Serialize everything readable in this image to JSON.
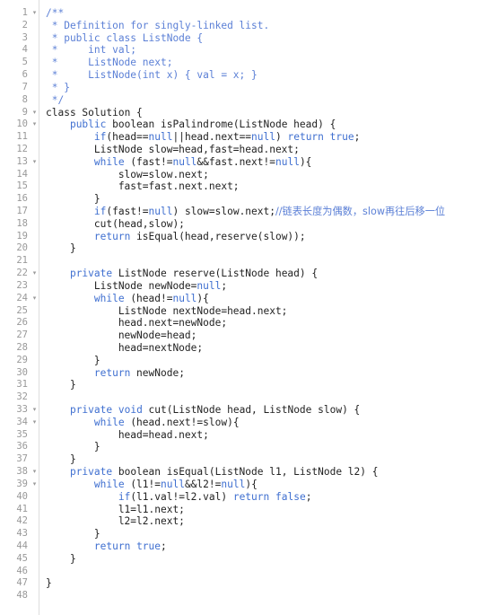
{
  "editor": {
    "name": "code-editor",
    "language": "java",
    "total_lines": 48,
    "colors": {
      "background": "#ffffff",
      "gutter_text": "#999999",
      "gutter_rule": "#dddddd",
      "comment": "#5c80d6",
      "keyword": "#3f6fd0",
      "literal": "#5a7fd4",
      "plain": "#222222",
      "fold_marker": "#9a9a9a"
    },
    "fold_marker_glyph": "▾",
    "fold_lines": [
      1,
      9,
      10,
      13,
      22,
      24,
      33,
      34,
      38,
      39
    ],
    "lines": [
      {
        "n": 1,
        "fold": true,
        "tokens": [
          {
            "t": "/**",
            "c": "cmt"
          }
        ]
      },
      {
        "n": 2,
        "fold": false,
        "tokens": [
          {
            "t": " * Definition for singly-linked list.",
            "c": "cmt"
          }
        ]
      },
      {
        "n": 3,
        "fold": false,
        "tokens": [
          {
            "t": " * public class ListNode {",
            "c": "cmt"
          }
        ]
      },
      {
        "n": 4,
        "fold": false,
        "tokens": [
          {
            "t": " *     int val;",
            "c": "cmt"
          }
        ]
      },
      {
        "n": 5,
        "fold": false,
        "tokens": [
          {
            "t": " *     ListNode next;",
            "c": "cmt"
          }
        ]
      },
      {
        "n": 6,
        "fold": false,
        "tokens": [
          {
            "t": " *     ListNode(int x) { val = x; }",
            "c": "cmt"
          }
        ]
      },
      {
        "n": 7,
        "fold": false,
        "tokens": [
          {
            "t": " * }",
            "c": "cmt"
          }
        ]
      },
      {
        "n": 8,
        "fold": false,
        "tokens": [
          {
            "t": " */",
            "c": "cmt"
          }
        ]
      },
      {
        "n": 9,
        "fold": true,
        "tokens": [
          {
            "t": "class",
            "c": "plain"
          },
          {
            "t": " Solution {",
            "c": "plain"
          }
        ]
      },
      {
        "n": 10,
        "fold": true,
        "tokens": [
          {
            "t": "    ",
            "c": "plain"
          },
          {
            "t": "public",
            "c": "kw"
          },
          {
            "t": " boolean isPalindrome(ListNode head) {",
            "c": "plain"
          }
        ]
      },
      {
        "n": 11,
        "fold": false,
        "tokens": [
          {
            "t": "        ",
            "c": "plain"
          },
          {
            "t": "if",
            "c": "kw"
          },
          {
            "t": "(head==",
            "c": "plain"
          },
          {
            "t": "null",
            "c": "kw"
          },
          {
            "t": "||head.next==",
            "c": "plain"
          },
          {
            "t": "null",
            "c": "kw"
          },
          {
            "t": ") ",
            "c": "plain"
          },
          {
            "t": "return",
            "c": "kw"
          },
          {
            "t": " ",
            "c": "plain"
          },
          {
            "t": "true",
            "c": "kw"
          },
          {
            "t": ";",
            "c": "plain"
          }
        ]
      },
      {
        "n": 12,
        "fold": false,
        "tokens": [
          {
            "t": "        ListNode slow=head,fast=head.next;",
            "c": "plain"
          }
        ]
      },
      {
        "n": 13,
        "fold": true,
        "tokens": [
          {
            "t": "        ",
            "c": "plain"
          },
          {
            "t": "while",
            "c": "kw"
          },
          {
            "t": " (fast!=",
            "c": "plain"
          },
          {
            "t": "null",
            "c": "kw"
          },
          {
            "t": "&&fast.next!=",
            "c": "plain"
          },
          {
            "t": "null",
            "c": "kw"
          },
          {
            "t": "){",
            "c": "plain"
          }
        ]
      },
      {
        "n": 14,
        "fold": false,
        "tokens": [
          {
            "t": "            slow=slow.next;",
            "c": "plain"
          }
        ]
      },
      {
        "n": 15,
        "fold": false,
        "tokens": [
          {
            "t": "            fast=fast.next.next;",
            "c": "plain"
          }
        ]
      },
      {
        "n": 16,
        "fold": false,
        "tokens": [
          {
            "t": "        }",
            "c": "plain"
          }
        ]
      },
      {
        "n": 17,
        "fold": false,
        "tokens": [
          {
            "t": "        ",
            "c": "plain"
          },
          {
            "t": "if",
            "c": "kw"
          },
          {
            "t": "(fast!=",
            "c": "plain"
          },
          {
            "t": "null",
            "c": "kw"
          },
          {
            "t": ") slow=slow.next;",
            "c": "plain"
          },
          {
            "t": "//链表长度为偶数，slow再往后移一位",
            "c": "cjk"
          }
        ]
      },
      {
        "n": 18,
        "fold": false,
        "tokens": [
          {
            "t": "        cut(head,slow);",
            "c": "plain"
          }
        ]
      },
      {
        "n": 19,
        "fold": false,
        "tokens": [
          {
            "t": "        ",
            "c": "plain"
          },
          {
            "t": "return",
            "c": "kw"
          },
          {
            "t": " isEqual(head,reserve(slow));",
            "c": "plain"
          }
        ]
      },
      {
        "n": 20,
        "fold": false,
        "tokens": [
          {
            "t": "    }",
            "c": "plain"
          }
        ]
      },
      {
        "n": 21,
        "fold": false,
        "tokens": [
          {
            "t": "",
            "c": "plain"
          }
        ]
      },
      {
        "n": 22,
        "fold": true,
        "tokens": [
          {
            "t": "    ",
            "c": "plain"
          },
          {
            "t": "private",
            "c": "kw"
          },
          {
            "t": " ListNode reserve(ListNode head) {",
            "c": "plain"
          }
        ]
      },
      {
        "n": 23,
        "fold": false,
        "tokens": [
          {
            "t": "        ListNode newNode=",
            "c": "plain"
          },
          {
            "t": "null",
            "c": "kw"
          },
          {
            "t": ";",
            "c": "plain"
          }
        ]
      },
      {
        "n": 24,
        "fold": true,
        "tokens": [
          {
            "t": "        ",
            "c": "plain"
          },
          {
            "t": "while",
            "c": "kw"
          },
          {
            "t": " (head!=",
            "c": "plain"
          },
          {
            "t": "null",
            "c": "kw"
          },
          {
            "t": "){",
            "c": "plain"
          }
        ]
      },
      {
        "n": 25,
        "fold": false,
        "tokens": [
          {
            "t": "            ListNode nextNode=head.next;",
            "c": "plain"
          }
        ]
      },
      {
        "n": 26,
        "fold": false,
        "tokens": [
          {
            "t": "            head.next=newNode;",
            "c": "plain"
          }
        ]
      },
      {
        "n": 27,
        "fold": false,
        "tokens": [
          {
            "t": "            newNode=head;",
            "c": "plain"
          }
        ]
      },
      {
        "n": 28,
        "fold": false,
        "tokens": [
          {
            "t": "            head=nextNode;",
            "c": "plain"
          }
        ]
      },
      {
        "n": 29,
        "fold": false,
        "tokens": [
          {
            "t": "        }",
            "c": "plain"
          }
        ]
      },
      {
        "n": 30,
        "fold": false,
        "tokens": [
          {
            "t": "        ",
            "c": "plain"
          },
          {
            "t": "return",
            "c": "kw"
          },
          {
            "t": " newNode;",
            "c": "plain"
          }
        ]
      },
      {
        "n": 31,
        "fold": false,
        "tokens": [
          {
            "t": "    }",
            "c": "plain"
          }
        ]
      },
      {
        "n": 32,
        "fold": false,
        "tokens": [
          {
            "t": "",
            "c": "plain"
          }
        ]
      },
      {
        "n": 33,
        "fold": true,
        "tokens": [
          {
            "t": "    ",
            "c": "plain"
          },
          {
            "t": "private",
            "c": "kw"
          },
          {
            "t": " ",
            "c": "plain"
          },
          {
            "t": "void",
            "c": "kw"
          },
          {
            "t": " cut(ListNode head, ListNode slow) {",
            "c": "plain"
          }
        ]
      },
      {
        "n": 34,
        "fold": true,
        "tokens": [
          {
            "t": "        ",
            "c": "plain"
          },
          {
            "t": "while",
            "c": "kw"
          },
          {
            "t": " (head.next!=slow){",
            "c": "plain"
          }
        ]
      },
      {
        "n": 35,
        "fold": false,
        "tokens": [
          {
            "t": "            head=head.next;",
            "c": "plain"
          }
        ]
      },
      {
        "n": 36,
        "fold": false,
        "tokens": [
          {
            "t": "        }",
            "c": "plain"
          }
        ]
      },
      {
        "n": 37,
        "fold": false,
        "tokens": [
          {
            "t": "    }",
            "c": "plain"
          }
        ]
      },
      {
        "n": 38,
        "fold": true,
        "tokens": [
          {
            "t": "    ",
            "c": "plain"
          },
          {
            "t": "private",
            "c": "kw"
          },
          {
            "t": " boolean isEqual(ListNode l1, ListNode l2) {",
            "c": "plain"
          }
        ]
      },
      {
        "n": 39,
        "fold": true,
        "tokens": [
          {
            "t": "        ",
            "c": "plain"
          },
          {
            "t": "while",
            "c": "kw"
          },
          {
            "t": " (l1!=",
            "c": "plain"
          },
          {
            "t": "null",
            "c": "kw"
          },
          {
            "t": "&&l2!=",
            "c": "plain"
          },
          {
            "t": "null",
            "c": "kw"
          },
          {
            "t": "){",
            "c": "plain"
          }
        ]
      },
      {
        "n": 40,
        "fold": false,
        "tokens": [
          {
            "t": "            ",
            "c": "plain"
          },
          {
            "t": "if",
            "c": "kw"
          },
          {
            "t": "(l1.val!=l2.val) ",
            "c": "plain"
          },
          {
            "t": "return",
            "c": "kw"
          },
          {
            "t": " ",
            "c": "plain"
          },
          {
            "t": "false",
            "c": "kw"
          },
          {
            "t": ";",
            "c": "plain"
          }
        ]
      },
      {
        "n": 41,
        "fold": false,
        "tokens": [
          {
            "t": "            l1=l1.next;",
            "c": "plain"
          }
        ]
      },
      {
        "n": 42,
        "fold": false,
        "tokens": [
          {
            "t": "            l2=l2.next;",
            "c": "plain"
          }
        ]
      },
      {
        "n": 43,
        "fold": false,
        "tokens": [
          {
            "t": "        }",
            "c": "plain"
          }
        ]
      },
      {
        "n": 44,
        "fold": false,
        "tokens": [
          {
            "t": "        ",
            "c": "plain"
          },
          {
            "t": "return",
            "c": "kw"
          },
          {
            "t": " ",
            "c": "plain"
          },
          {
            "t": "true",
            "c": "kw"
          },
          {
            "t": ";",
            "c": "plain"
          }
        ]
      },
      {
        "n": 45,
        "fold": false,
        "tokens": [
          {
            "t": "    }",
            "c": "plain"
          }
        ]
      },
      {
        "n": 46,
        "fold": false,
        "tokens": [
          {
            "t": "",
            "c": "plain"
          }
        ]
      },
      {
        "n": 47,
        "fold": false,
        "tokens": [
          {
            "t": "}",
            "c": "plain"
          }
        ]
      },
      {
        "n": 48,
        "fold": false,
        "tokens": [
          {
            "t": "",
            "c": "plain"
          }
        ]
      }
    ]
  }
}
